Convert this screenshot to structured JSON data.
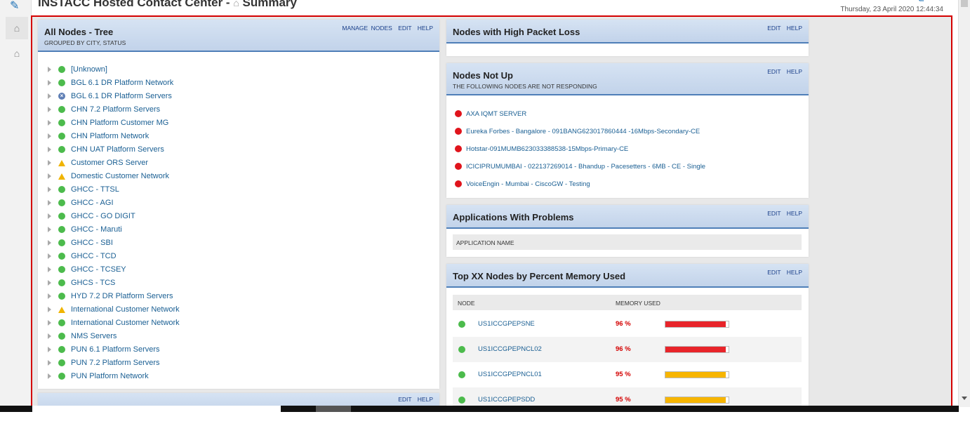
{
  "page": {
    "title": "INSTACC Hosted Contact Center - ",
    "home_glyph": "⌂",
    "summary": "Summary",
    "datetime": "Thursday, 23 April 2020 12:44:34"
  },
  "all_nodes": {
    "title": "All Nodes - Tree",
    "subtitle": "GROUPED BY CITY, STATUS",
    "links": [
      "MANAGE NODES",
      "EDIT",
      "HELP"
    ],
    "items": [
      {
        "label": "[Unknown]",
        "status": "green"
      },
      {
        "label": "BGL 6.1 DR Platform Network",
        "status": "green"
      },
      {
        "label": "BGL 6.1 DR Platform Servers",
        "status": "unknown"
      },
      {
        "label": "CHN 7.2 Platform Servers",
        "status": "green"
      },
      {
        "label": "CHN Platform Customer MG",
        "status": "green"
      },
      {
        "label": "CHN Platform Network",
        "status": "green"
      },
      {
        "label": "CHN UAT Platform Servers",
        "status": "green"
      },
      {
        "label": "Customer ORS Server",
        "status": "warning"
      },
      {
        "label": "Domestic Customer Network",
        "status": "warning"
      },
      {
        "label": "GHCC - TTSL",
        "status": "green"
      },
      {
        "label": "GHCC - AGI",
        "status": "green"
      },
      {
        "label": "GHCC - GO DIGIT",
        "status": "green"
      },
      {
        "label": "GHCC - Maruti",
        "status": "green"
      },
      {
        "label": "GHCC - SBI",
        "status": "green"
      },
      {
        "label": "GHCC - TCD",
        "status": "green"
      },
      {
        "label": "GHCC - TCSEY",
        "status": "green"
      },
      {
        "label": "GHCS - TCS",
        "status": "green"
      },
      {
        "label": "HYD 7.2 DR Platform Servers",
        "status": "green"
      },
      {
        "label": "International Customer Network",
        "status": "warning"
      },
      {
        "label": "International Customer Network",
        "status": "green"
      },
      {
        "label": "NMS Servers",
        "status": "green"
      },
      {
        "label": "PUN 6.1 Platform Servers",
        "status": "green"
      },
      {
        "label": "PUN 7.2 Platform Servers",
        "status": "green"
      },
      {
        "label": "PUN Platform Network",
        "status": "green"
      }
    ]
  },
  "packet_loss": {
    "title": "Nodes with High Packet Loss",
    "links": [
      "EDIT",
      "HELP"
    ]
  },
  "not_up": {
    "title": "Nodes Not Up",
    "subtitle": "THE FOLLOWING NODES ARE NOT RESPONDING",
    "links": [
      "EDIT",
      "HELP"
    ],
    "items": [
      "AXA IQMT SERVER",
      "Eureka Forbes - Bangalore - 091BANG623017860444 -16Mbps-Secondary-CE",
      "Hotstar-091MUMB623033388538-15Mbps-Primary-CE",
      "ICICIPRUMUMBAI - 022137269014 - Bhandup - Pacesetters - 6MB - CE - Single",
      "VoiceEngin - Mumbai - CiscoGW - Testing"
    ]
  },
  "apps": {
    "title": "Applications With Problems",
    "links": [
      "EDIT",
      "HELP"
    ],
    "column": "APPLICATION NAME"
  },
  "memory": {
    "title": "Top XX Nodes by Percent Memory Used",
    "links": [
      "EDIT",
      "HELP"
    ],
    "columns": [
      "NODE",
      "MEMORY USED"
    ],
    "rows": [
      {
        "node": "US1ICCGPEPSNE",
        "pct_label": "96 %",
        "value": 96,
        "color": "#e8242a"
      },
      {
        "node": "US1ICCGPEPNCL02",
        "pct_label": "96 %",
        "value": 96,
        "color": "#e8242a"
      },
      {
        "node": "US1ICCGPEPNCL01",
        "pct_label": "95 %",
        "value": 95,
        "color": "#f7b500"
      },
      {
        "node": "US1ICCGPEPSDD",
        "pct_label": "95 %",
        "value": 95,
        "color": "#f7b500"
      }
    ]
  },
  "bottom_panel": {
    "links": [
      "EDIT",
      "HELP"
    ]
  }
}
